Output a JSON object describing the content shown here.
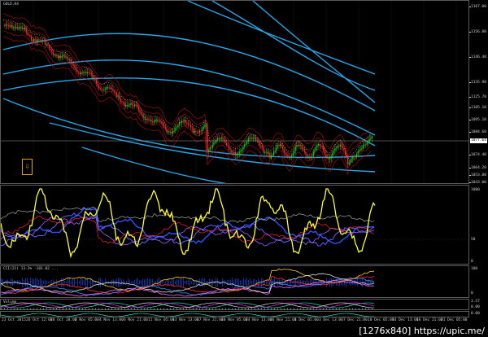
{
  "chart": {
    "symbol_label": "GOLD,H4",
    "current_price_badge": "1077.64",
    "side_marker": "1077.64",
    "price_ticks": [
      "1167.00",
      "1156.80",
      "1146.40",
      "1135.90",
      "1125.70",
      "1105.10",
      "1095.10",
      "1084.60",
      "1074.40",
      "1064.20",
      "1053.80",
      "1043.00"
    ],
    "osc1_ticks": [
      "1000",
      "50",
      "0"
    ],
    "osc2_ticks": [
      "100",
      "0"
    ],
    "osc3_ticks": [
      "3.57",
      "0.00"
    ],
    "osc4_ticks": [
      "0.00"
    ],
    "osc2_label": "CCI(21) 13.3% -101.02 ...",
    "osc3_label": "Volume",
    "osc4_label": "ATR(14) 0.00",
    "x_labels": [
      "23 Oct 2015",
      "26 Oct 12:00",
      "28 Oct 20:00",
      "2 Nov 05:00",
      "4 Nov 13:00",
      "6 Nov 21:00",
      "11 Nov 05:00",
      "13 Nov 13:00",
      "17 Nov 21:00",
      "20 Nov 05:00",
      "24 Nov 13:00",
      "26 Nov 21:00",
      "1 Dec 05:00",
      "3 Dec 13:00",
      "7 Dec 21:00",
      "10 Dec 05:00",
      "14 Dec 13:00",
      "16 Dec 21:00",
      "21 Dec 05:00"
    ],
    "arrow_glyph": "⇩"
  },
  "colors": {
    "background": "#000000",
    "bullish": "#22cc22",
    "bearish": "#ff3030",
    "envelope": "#29a6e6",
    "bands": "#b01010",
    "oscillator": "#ffff33",
    "signal": "#3050ff",
    "ma": "#ff66ff"
  },
  "watermark": "[1276x840] https://upic.me/"
}
